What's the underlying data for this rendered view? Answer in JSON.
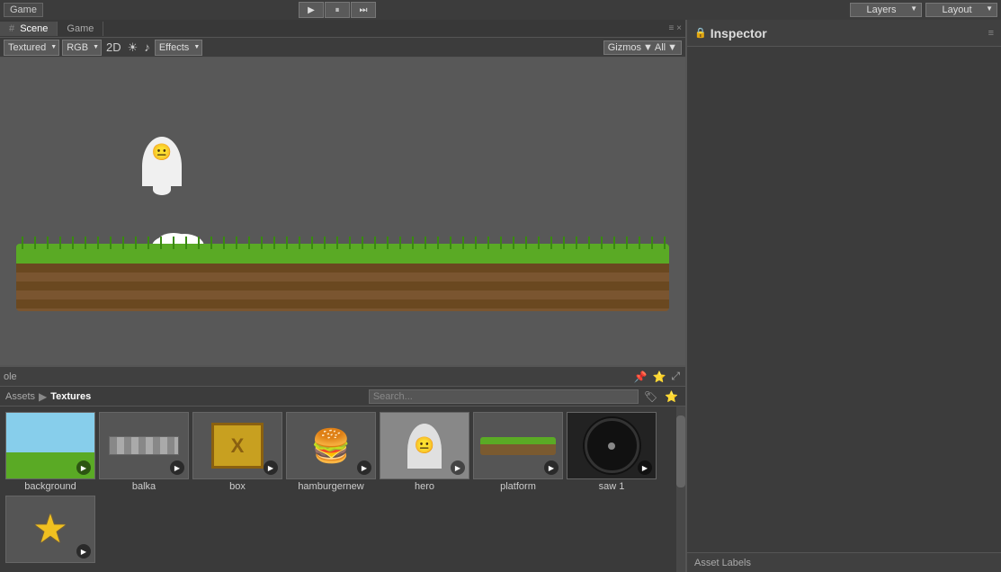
{
  "topbar": {
    "game_title": "Game",
    "transport": {
      "play": "▶",
      "pause": "⏸",
      "next": "⏭"
    },
    "layers_label": "Layers",
    "layout_label": "Layout"
  },
  "scene_tabs": [
    {
      "label": "Scene",
      "icon": "#",
      "active": true
    },
    {
      "label": "Game",
      "icon": "",
      "active": false
    }
  ],
  "toolbar": {
    "textured_label": "Textured",
    "rgb_label": "RGB",
    "view_2d": "2D",
    "effects_label": "Effects",
    "gizmos_label": "Gizmos",
    "all_label": "All"
  },
  "inspector": {
    "title": "Inspector",
    "lock_icon": "🔒"
  },
  "console": {
    "label": "ole"
  },
  "assets": {
    "breadcrumb": [
      "Assets",
      "Textures"
    ],
    "items": [
      {
        "id": "background",
        "label": "background",
        "type": "sky"
      },
      {
        "id": "balka",
        "label": "balka",
        "type": "balka"
      },
      {
        "id": "box",
        "label": "box",
        "type": "box"
      },
      {
        "id": "hamburgernew",
        "label": "hamburgernew",
        "type": "burger"
      },
      {
        "id": "hero",
        "label": "hero",
        "type": "hero"
      },
      {
        "id": "platform",
        "label": "platform",
        "type": "platform"
      },
      {
        "id": "saw1",
        "label": "saw 1",
        "type": "saw"
      },
      {
        "id": "star",
        "label": "",
        "type": "star"
      }
    ]
  },
  "asset_labels": {
    "title": "Asset Labels"
  }
}
